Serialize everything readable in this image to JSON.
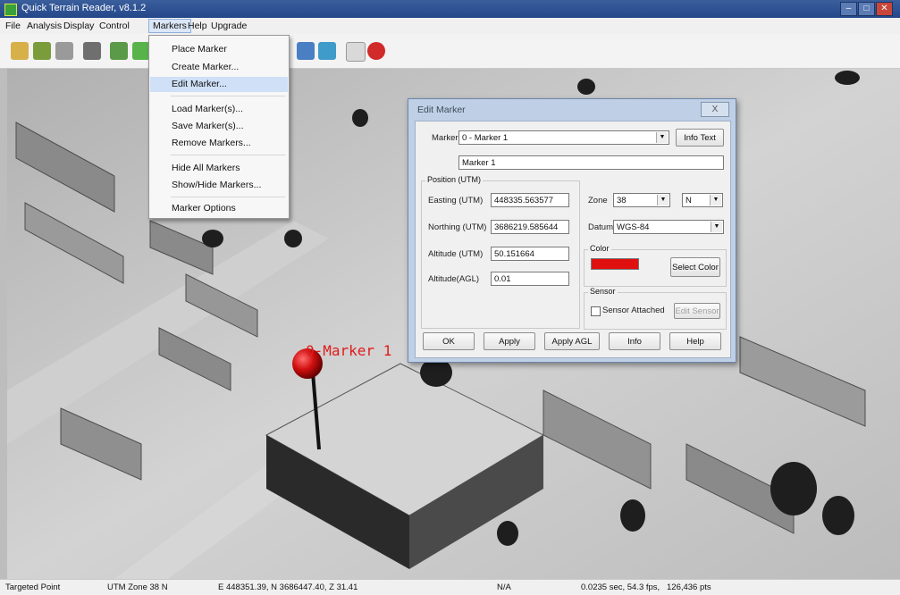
{
  "window": {
    "title": "Quick Terrain Reader, v8.1.2",
    "controls": [
      "–",
      "□",
      "✕"
    ]
  },
  "menu": [
    "File",
    "Analysis",
    "Display",
    "Control",
    "Markers",
    "Help",
    "Upgrade"
  ],
  "toolbar_icons": [
    "open-file-icon",
    "save-icon",
    "settings-icon",
    "print-icon",
    "home-icon",
    "terrain-icon",
    "chart-icon",
    "layers-icon",
    "help-icon",
    "stop-icon"
  ],
  "markers_menu": {
    "items": [
      "Place Marker",
      "Create Marker...",
      "Edit Marker...",
      "Load Marker(s)...",
      "Save Marker(s)...",
      "Remove Markers...",
      "Hide All Markers",
      "Show/Hide Markers...",
      "Marker Options"
    ],
    "highlighted": "Edit Marker..."
  },
  "viewport": {
    "marker_label": "0-Marker 1",
    "marker_color": "#d10f0f"
  },
  "dialog": {
    "title": "Edit Marker",
    "close": "X",
    "marker_label": "Marker",
    "marker_value": "0 - Marker 1",
    "info_text_button": "Info Text",
    "marker_name": "Marker 1",
    "position_group": "Position (UTM)",
    "easting_label": "Easting (UTM)",
    "easting_value": "448335.563577",
    "northing_label": "Northing (UTM)",
    "northing_value": "3686219.585644",
    "altitude_label": "Altitude (UTM)",
    "altitude_value": "50.151664",
    "altitude_agl_label": "Altitude(AGL)",
    "altitude_agl_value": "0.01",
    "zone_label": "Zone",
    "zone_value": "38",
    "hemisphere_value": "N",
    "datum_label": "Datum",
    "datum_value": "WGS-84",
    "color_group": "Color",
    "color_swatch": "#e01010",
    "select_color_button": "Select Color",
    "sensor_group": "Sensor",
    "sensor_checkbox": "Sensor Attached",
    "edit_sensor_button": "Edit Sensor",
    "buttons": {
      "ok": "OK",
      "apply": "Apply",
      "apply_agl": "Apply AGL",
      "info": "Info",
      "help": "Help"
    }
  },
  "status": {
    "left": "Targeted Point",
    "zone": "UTM Zone 38 N",
    "coords": "E 448351.39, N 3686447.40, Z 31.41",
    "na": "N/A",
    "perf": "0.0235 sec, 54.3 fps,",
    "pts": "126,436 pts"
  }
}
